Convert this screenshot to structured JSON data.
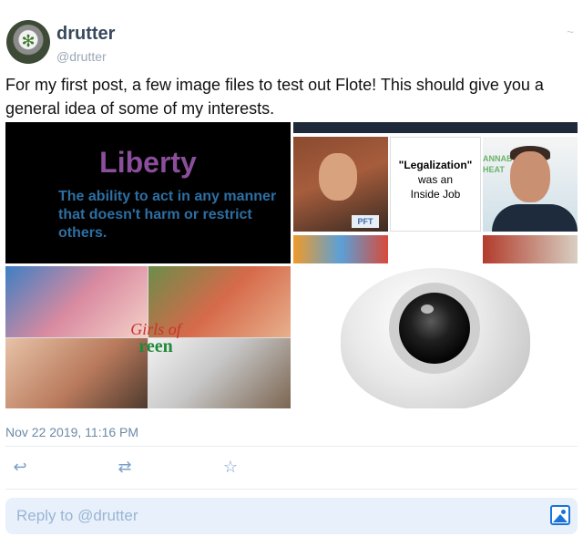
{
  "author": {
    "display_name": "drutter",
    "handle": "@drutter"
  },
  "post": {
    "text": "For my first post, a few image files to test out Flote! This should give you a general idea of some of my interests.",
    "timestamp": "Nov 22 2019, 11:16 PM"
  },
  "media": {
    "liberty": {
      "title": "Liberty",
      "text": "The ability to act in any manner that doesn't harm or restrict others."
    },
    "legalization": {
      "quote": "\"Legalization\"",
      "line2": "was an",
      "line3": "Inside Job",
      "mic_label": "PFT",
      "badge_text": "ANNAB HEAT"
    },
    "girls_of_green": {
      "logo_top": "Girls of",
      "logo_bottom": "reen"
    },
    "webcam": {}
  },
  "actions": {
    "reply_icon": "reply-arrow-icon",
    "repost_icon": "repost-icon",
    "favorite_icon": "star-icon"
  },
  "reply": {
    "placeholder": "Reply to @drutter"
  },
  "colors": {
    "name": "#37495c",
    "handle": "#9aa8b6",
    "timestamp": "#6a8aa7",
    "action": "#7a9fc9",
    "reply_bg": "#e8f1fb",
    "accent": "#1b73d8"
  }
}
